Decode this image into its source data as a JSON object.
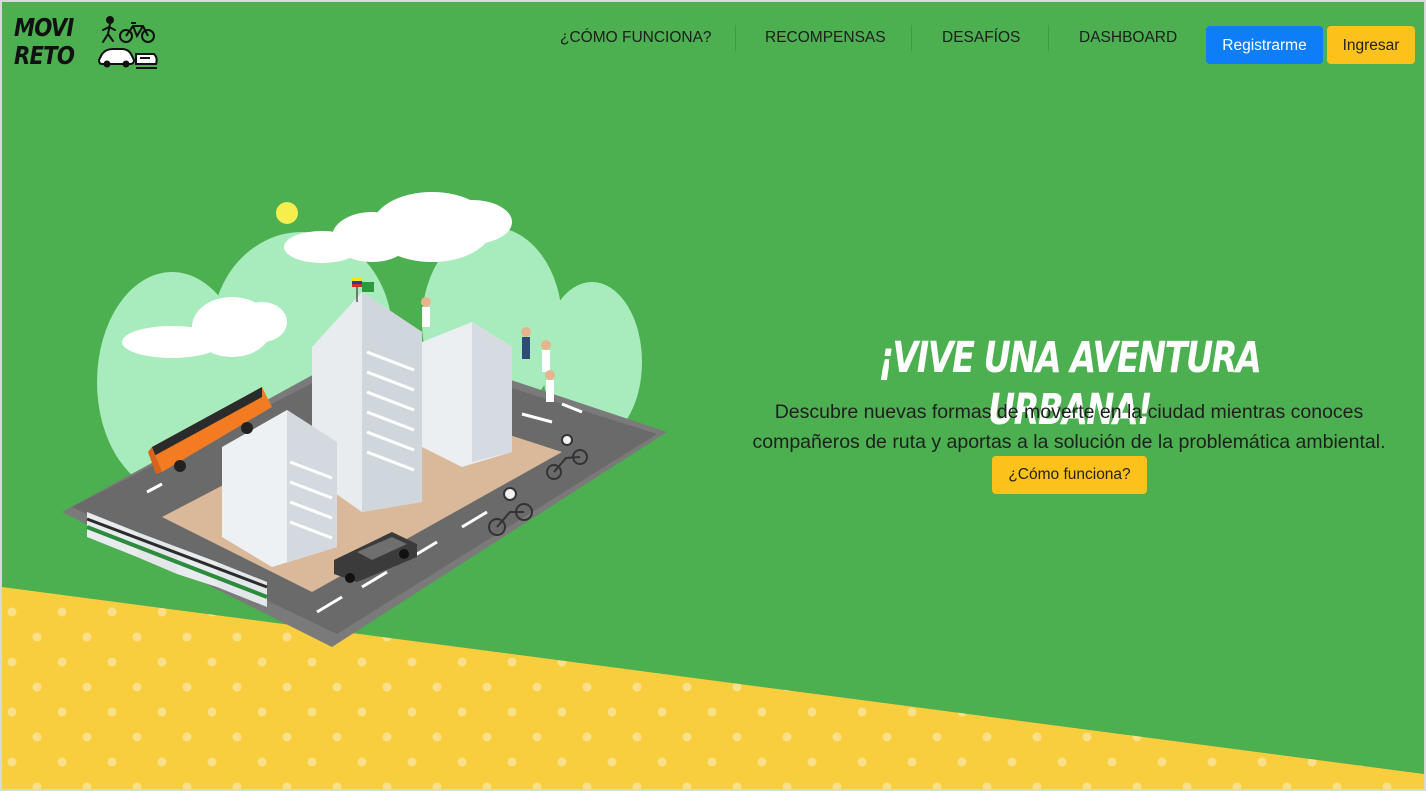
{
  "brand": {
    "logo_line1": "MOVI",
    "logo_line2": "RETO"
  },
  "nav": {
    "items": [
      {
        "label": "¿CÓMO FUNCIONA?"
      },
      {
        "label": "RECOMPENSAS"
      },
      {
        "label": "DESAFÍOS"
      },
      {
        "label": "DASHBOARD"
      }
    ],
    "register_label": "Registrarme",
    "login_label": "Ingresar"
  },
  "hero": {
    "title": "¡VIVE UNA AVENTURA URBANA!",
    "description": "Descubre nuevas formas de moverte en la ciudad mientras conoces compañeros de ruta y aportas a la solución de la problemática ambiental.",
    "cta_label": "¿Cómo funciona?"
  },
  "colors": {
    "background": "#4caf50",
    "accent_yellow": "#fcc21b",
    "wedge_yellow": "#f8cd3e",
    "primary_blue": "#0d7ef8"
  },
  "icons": [
    "pedestrian-icon",
    "bicycle-icon",
    "car-icon",
    "train-icon"
  ]
}
